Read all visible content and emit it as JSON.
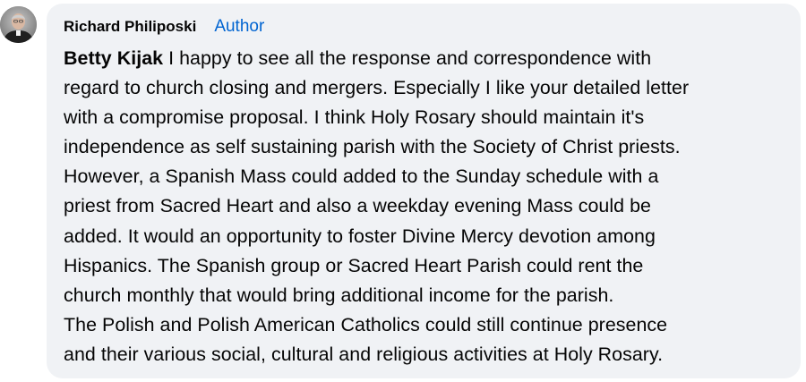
{
  "comment": {
    "author": "Richard Philiposki",
    "badge": "Author",
    "mention": "Betty Kijak",
    "lines": [
      " I happy to see all the response and correspondence with",
      "regard to church closing and mergers. Especially I like your detailed letter",
      "with a compromise proposal. I think Holy Rosary should maintain it's",
      "independence as self sustaining parish with the Society of Christ priests.",
      "However, a Spanish Mass could added to the Sunday schedule with a",
      "priest from Sacred Heart and also a weekday evening Mass could be",
      "added. It would an opportunity to foster Divine Mercy devotion among",
      "Hispanics. The Spanish group or Sacred Heart Parish could rent the",
      "church monthly that would bring additional income for the parish.",
      "The Polish and Polish American Catholics could still continue presence",
      "and their various social, cultural and religious activities at Holy Rosary."
    ]
  },
  "colors": {
    "bubble_bg": "#f0f2f5",
    "author_badge": "#0064d1",
    "text": "#050505"
  },
  "icons": {
    "avatar": "profile-photo-avatar"
  }
}
